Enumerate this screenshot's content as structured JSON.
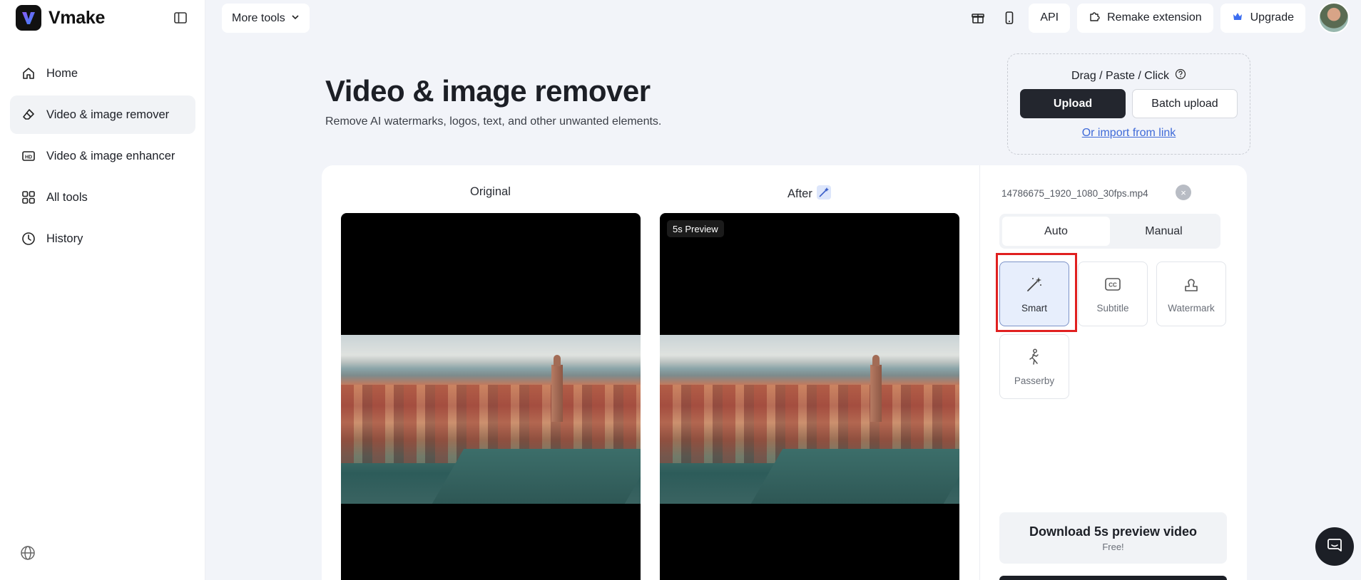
{
  "brand": {
    "name": "Vmake",
    "logo_icon": "vmake-logo-icon"
  },
  "sidebar": {
    "items": [
      {
        "label": "Home",
        "icon": "home-icon"
      },
      {
        "label": "Video & image remover",
        "icon": "eraser-icon",
        "active": true
      },
      {
        "label": "Video & image enhancer",
        "icon": "hd-icon"
      },
      {
        "label": "All tools",
        "icon": "grid-icon"
      },
      {
        "label": "History",
        "icon": "clock-icon"
      }
    ],
    "language_icon": "globe-icon"
  },
  "topbar": {
    "more_tools": "More tools",
    "api": "API",
    "remake_extension": "Remake extension",
    "upgrade": "Upgrade"
  },
  "hero": {
    "title": "Video & image remover",
    "subtitle": "Remove AI watermarks, logos, text, and other unwanted elements."
  },
  "upload": {
    "hint": "Drag / Paste / Click",
    "upload_label": "Upload",
    "batch_label": "Batch upload",
    "import_link": "Or import from link"
  },
  "compare": {
    "original_label": "Original",
    "after_label": "After",
    "preview_badge": "5s Preview"
  },
  "right_panel": {
    "file_name": "14786675_1920_1080_30fps.mp4",
    "tabs": [
      "Auto",
      "Manual"
    ],
    "active_tab": "Auto",
    "tools": [
      {
        "label": "Smart",
        "icon": "magic-wand-icon",
        "selected": true
      },
      {
        "label": "Subtitle",
        "icon": "cc-icon"
      },
      {
        "label": "Watermark",
        "icon": "stamp-icon"
      },
      {
        "label": "Passerby",
        "icon": "walking-person-icon"
      }
    ],
    "download": {
      "title": "Download 5s preview video",
      "subtitle": "Free!"
    }
  },
  "colors": {
    "accent_dark": "#23262e",
    "link": "#3f6ad8",
    "selected_bg": "#e7eefc",
    "highlight": "#e02020"
  }
}
